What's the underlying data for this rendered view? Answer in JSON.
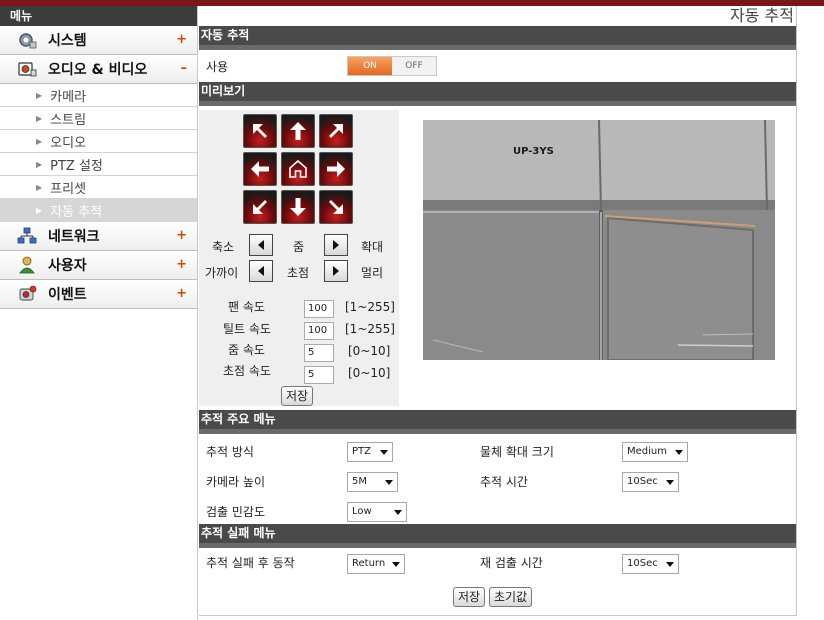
{
  "sidebar": {
    "header": "메뉴",
    "main_items": [
      {
        "label": "시스템",
        "sign": "+"
      },
      {
        "label": "오디오 & 비디오",
        "sign": "–"
      },
      {
        "label": "네트워크",
        "sign": "+"
      },
      {
        "label": "사용자",
        "sign": "+"
      },
      {
        "label": "이벤트",
        "sign": "+"
      }
    ],
    "sub_items": [
      {
        "label": "카메라"
      },
      {
        "label": "스트림"
      },
      {
        "label": "오디오"
      },
      {
        "label": "PTZ 설정"
      },
      {
        "label": "프리셋"
      },
      {
        "label": "자동 추적"
      }
    ]
  },
  "page": {
    "title": "자동 추적"
  },
  "auto_tracking": {
    "section_title": "자동 추적",
    "enable_label": "사용",
    "toggle_on": "ON",
    "toggle_off": "OFF",
    "toggle_state": "ON"
  },
  "preview": {
    "section_title": "미리보기",
    "zoom_out": "축소",
    "zoom": "줌",
    "zoom_in": "확대",
    "focus_near": "가까이",
    "focus": "초점",
    "focus_far": "멀리",
    "pan_speed_label": "팬 속도",
    "pan_speed": "100",
    "pan_range": "[1~255]",
    "tilt_speed_label": "틸트 속도",
    "tilt_speed": "100",
    "tilt_range": "[1~255]",
    "zoom_speed_label": "줌 속도",
    "zoom_speed": "5",
    "zoom_range": "[0~10]",
    "focus_speed_label": "초점 속도",
    "focus_speed": "5",
    "focus_range": "[0~10]",
    "save": "저장",
    "cam_overlay": "UP-3YS"
  },
  "tracking_main": {
    "section_title": "추적 주요 메뉴",
    "method_label": "추적 방식",
    "method_value": "PTZ",
    "zoom_size_label": "물체 확대 크기",
    "zoom_size_value": "Medium",
    "height_label": "카메라 높이",
    "height_value": "5M",
    "time_label": "추적 시간",
    "time_value": "10Sec",
    "sensitivity_label": "검출 민감도",
    "sensitivity_value": "Low"
  },
  "tracking_fail": {
    "section_title": "추적 실패 메뉴",
    "action_label": "추적 실패 후 동작",
    "action_value": "Return",
    "redetect_label": "재 검출 시간",
    "redetect_value": "10Sec"
  },
  "footer": {
    "save": "저장",
    "reset": "초기값"
  },
  "colors": {
    "accent": "#e4671a",
    "section_bar": "#4a4a4a",
    "ptz_red": "#c81e1e",
    "top_strip": "#7a1616"
  }
}
